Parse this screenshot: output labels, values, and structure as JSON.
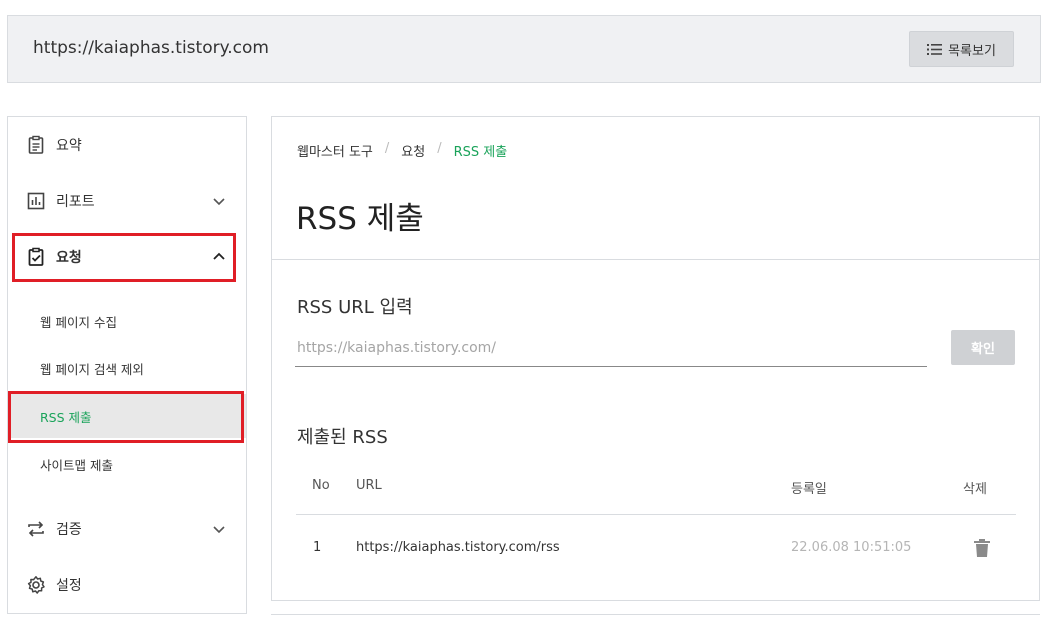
{
  "header": {
    "site_url": "https://kaiaphas.tistory.com",
    "list_button_label": "목록보기",
    "list_icon": "list-icon"
  },
  "sidebar": {
    "items": [
      {
        "label": "요약",
        "icon": "clipboard-icon"
      },
      {
        "label": "리포트",
        "icon": "bar-chart-icon"
      },
      {
        "label": "요청",
        "icon": "clipboard-check-icon"
      },
      {
        "label": "검증",
        "icon": "repeat-icon"
      },
      {
        "label": "설정",
        "icon": "gear-icon"
      }
    ],
    "sub_items": [
      {
        "label": "웹 페이지 수집"
      },
      {
        "label": "웹 페이지 검색 제외"
      },
      {
        "label": "RSS 제출"
      },
      {
        "label": "사이트맵 제출"
      }
    ]
  },
  "main": {
    "breadcrumb": [
      "웹마스터 도구",
      "요청",
      "RSS 제출"
    ],
    "title": "RSS 제출",
    "rss_url_label": "RSS URL 입력",
    "rss_input_placeholder": "https://kaiaphas.tistory.com/",
    "confirm_label": "확인",
    "submitted_label": "제출된 RSS",
    "table": {
      "headers": [
        "No",
        "URL",
        "등록일",
        "삭제"
      ],
      "rows": [
        {
          "no": "1",
          "url": "https://kaiaphas.tistory.com/rss",
          "date": "22.06.08 10:51:05"
        }
      ]
    }
  },
  "colors": {
    "accent_green": "#1aa35a",
    "highlight_red": "#e01e26",
    "button_gray": "#cfd1d4"
  }
}
